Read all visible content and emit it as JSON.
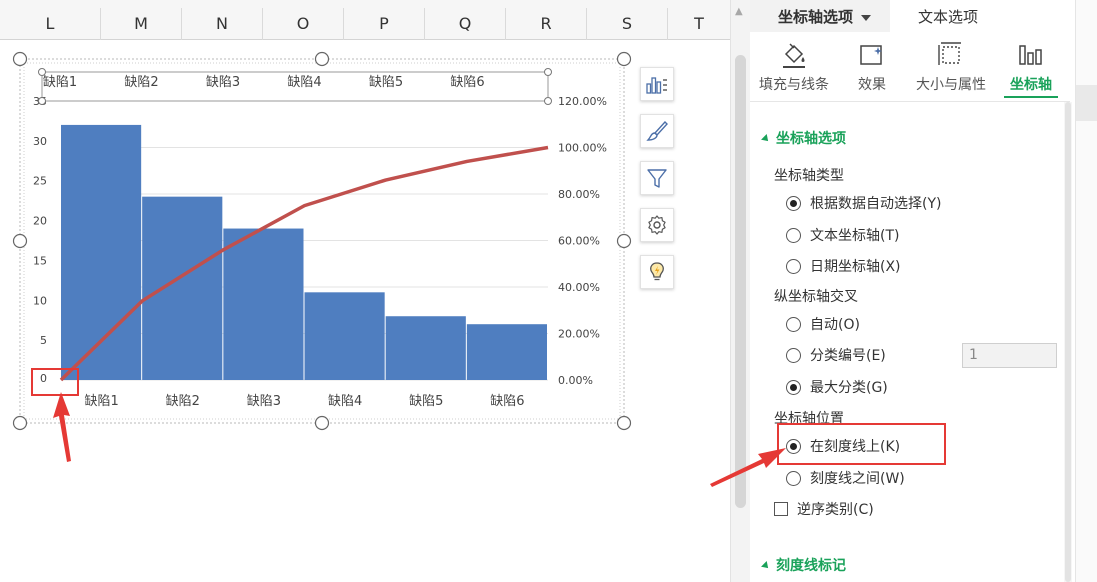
{
  "sheet": {
    "columns": [
      "L",
      "M",
      "N",
      "O",
      "P",
      "Q",
      "R",
      "S",
      "T"
    ]
  },
  "chart_data": {
    "type": "bar",
    "categories": [
      "缺陷1",
      "缺陷2",
      "缺陷3",
      "缺陷4",
      "缺陷5",
      "缺陷6"
    ],
    "top_axis_labels": [
      "缺陷1",
      "缺陷2",
      "缺陷3",
      "缺陷4",
      "缺陷5",
      "缺陷6"
    ],
    "bar_values": [
      32,
      23,
      19,
      11,
      8,
      7
    ],
    "line_values_pct": [
      0,
      34.0,
      56.0,
      75.0,
      86.0,
      94.0,
      100.0
    ],
    "ylim": [
      0,
      35
    ],
    "y_ticks": [
      "0",
      "5",
      "10",
      "15",
      "20",
      "25",
      "30",
      "35"
    ],
    "y2lim": [
      0,
      120
    ],
    "y2_ticks": [
      "0.00%",
      "20.00%",
      "40.00%",
      "60.00%",
      "80.00%",
      "100.00%",
      "120.00%"
    ],
    "bar_color": "#4f7ec0",
    "line_color": "#c0504d",
    "grid": true
  },
  "chart_tools": [
    {
      "name": "chart-elements-icon"
    },
    {
      "name": "chart-style-icon"
    },
    {
      "name": "chart-filter-icon"
    },
    {
      "name": "chart-settings-icon"
    },
    {
      "name": "chart-quick-idea-icon"
    }
  ],
  "pane": {
    "tab_axis_options": "坐标轴选项",
    "tab_text_options": "文本选项",
    "subtabs": [
      "填充与线条",
      "效果",
      "大小与属性",
      "坐标轴"
    ],
    "section_axis_options": "坐标轴选项",
    "axis_type_label": "坐标轴类型",
    "axis_type_options": [
      "根据数据自动选择(Y)",
      "文本坐标轴(T)",
      "日期坐标轴(X)"
    ],
    "cross_label": "纵坐标轴交叉",
    "cross_options": [
      "自动(O)",
      "分类编号(E)",
      "最大分类(G)"
    ],
    "category_number_value": "1",
    "position_label": "坐标轴位置",
    "position_options": [
      "在刻度线上(K)",
      "刻度线之间(W)"
    ],
    "reverse_label": "逆序类别(C)",
    "section_tick_marks": "刻度线标记",
    "accent_color": "#1aa25a"
  }
}
